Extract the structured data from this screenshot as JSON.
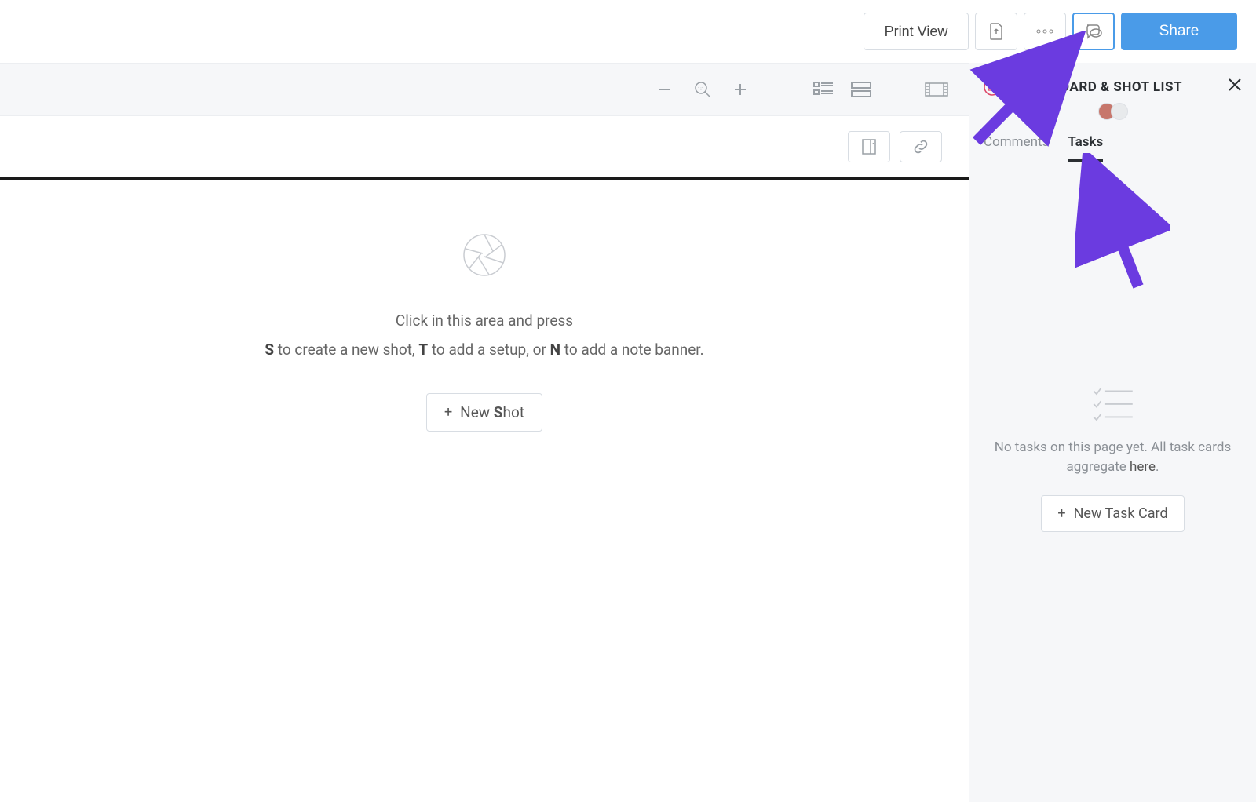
{
  "topbar": {
    "print_label": "Print View",
    "share_label": "Share"
  },
  "canvas": {
    "hint_line1": "Click in this area and press",
    "hint_key_s": "S",
    "hint_text_s": " to create a new shot, ",
    "hint_key_t": "T",
    "hint_text_t": " to add a setup, or ",
    "hint_key_n": "N",
    "hint_text_n": " to add a note banner.",
    "new_shot_pre": "New ",
    "new_shot_key": "S",
    "new_shot_post": "hot"
  },
  "panel": {
    "title": "STORYBOARD & SHOT LIST",
    "avatar_extra": "",
    "tabs": {
      "comments": "Comments",
      "tasks": "Tasks"
    },
    "tasks_empty_pre": "No tasks on this page yet. All task cards aggregate ",
    "tasks_empty_link": "here",
    "tasks_empty_post": ".",
    "new_task_label": "New Task Card"
  }
}
